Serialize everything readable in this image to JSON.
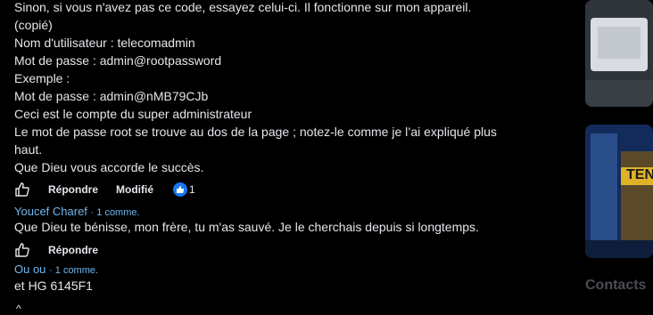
{
  "post": {
    "lines": [
      "Sinon, si vous n'avez pas ce code, essayez celui-ci. Il fonctionne sur mon appareil.",
      "(copié)",
      "Nom d'utilisateur : telecomadmin",
      "Mot de passe : admin@rootpassword",
      "Exemple :",
      "Mot de passe : admin@nMB79CJb",
      "Ceci est le compte du super administrateur",
      "Le mot de passe root se trouve au dos de la page ; notez-le comme je l’ai expliqué plus",
      "haut.",
      "Que Dieu vous accorde le succès."
    ],
    "actions": {
      "reply": "Répondre",
      "edited": "Modifié",
      "reaction_count": "1"
    }
  },
  "comment1": {
    "author": "Youcef Charef",
    "meta": "· 1 comme.",
    "text": "Que Dieu te bénisse, mon frère, tu m'as sauvé. Je le cherchais depuis si longtemps.",
    "reply": "Répondre"
  },
  "comment2": {
    "author": "Ou ou",
    "meta": "· 1 comme.",
    "text": "et HG 6145F1"
  },
  "sidebar": {
    "contacts_label": "Contacts",
    "ad_text": "TEN"
  }
}
